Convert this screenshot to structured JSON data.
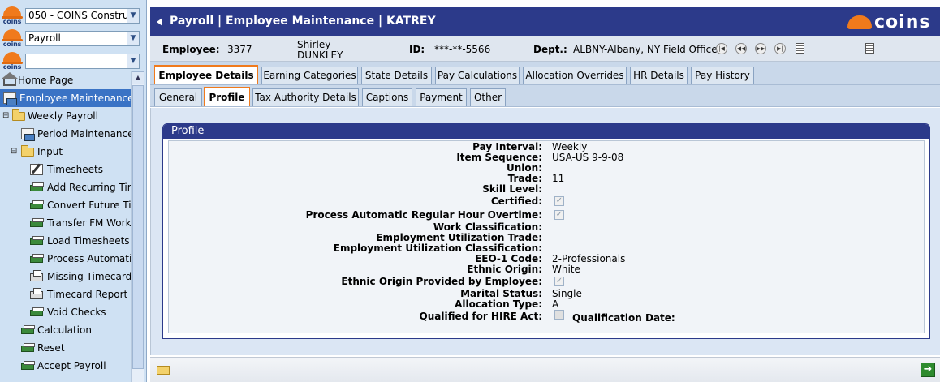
{
  "sidebar": {
    "company_select": "050 - COINS Constru",
    "module_select": "Payroll",
    "third_select": "",
    "logo_text": "coins",
    "tree": [
      {
        "label": "Home Page",
        "icon": "home-icon"
      },
      {
        "label": "Employee Maintenance",
        "icon": "document-icon",
        "active": true
      },
      {
        "label": "Weekly Payroll",
        "icon": "folder-icon"
      },
      {
        "label": "Period Maintenance",
        "icon": "document-icon"
      },
      {
        "label": "Input",
        "icon": "folder-icon"
      },
      {
        "label": "Timesheets",
        "icon": "edit-icon"
      },
      {
        "label": "Add Recurring Tim",
        "icon": "money-icon"
      },
      {
        "label": "Convert Future Ti",
        "icon": "money-icon"
      },
      {
        "label": "Transfer FM Work",
        "icon": "money-icon"
      },
      {
        "label": "Load Timesheets",
        "icon": "money-icon"
      },
      {
        "label": "Process Automatic",
        "icon": "money-icon"
      },
      {
        "label": "Missing Timecard",
        "icon": "printer-icon"
      },
      {
        "label": "Timecard Report",
        "icon": "printer-icon"
      },
      {
        "label": "Void Checks",
        "icon": "money-icon"
      },
      {
        "label": "Calculation",
        "icon": "money-icon"
      },
      {
        "label": "Reset",
        "icon": "money-icon"
      },
      {
        "label": "Accept Payroll",
        "icon": "money-icon"
      }
    ]
  },
  "header": {
    "title": "Payroll | Employee Maintenance | KATREY",
    "brand": "coins"
  },
  "employee": {
    "label": "Employee:",
    "number": "3377",
    "first": "Shirley",
    "last": "DUNKLEY",
    "id_label": "ID:",
    "id": "***-**-5566",
    "dept_label": "Dept.:",
    "dept": "ALBNY-Albany, NY Field Office"
  },
  "tabs_primary": [
    "Employee Details",
    "Earning Categories",
    "State Details",
    "Pay Calculations",
    "Allocation Overrides",
    "HR Details",
    "Pay History"
  ],
  "tabs_secondary": [
    "General",
    "Profile",
    "Tax Authority Details",
    "Captions",
    "Payment",
    "Other"
  ],
  "profile": {
    "title": "Profile",
    "fields": {
      "pay_interval": {
        "label": "Pay Interval:",
        "value": "Weekly"
      },
      "item_sequence": {
        "label": "Item Sequence:",
        "value": "USA-US 9-9-08"
      },
      "union": {
        "label": "Union:",
        "value": ""
      },
      "trade": {
        "label": "Trade:",
        "value": "11"
      },
      "skill_level": {
        "label": "Skill Level:",
        "value": ""
      },
      "certified": {
        "label": "Certified:",
        "checked": true
      },
      "auto_overtime": {
        "label": "Process Automatic Regular Hour Overtime:",
        "checked": true
      },
      "work_class": {
        "label": "Work Classification:",
        "value": ""
      },
      "emp_util_trade": {
        "label": "Employment Utilization Trade:",
        "value": ""
      },
      "emp_util_class": {
        "label": "Employment Utilization Classification:",
        "value": ""
      },
      "eeo1": {
        "label": "EEO-1 Code:",
        "value": "2-Professionals"
      },
      "ethnic": {
        "label": "Ethnic Origin:",
        "value": "White"
      },
      "ethnic_provided": {
        "label": "Ethnic Origin Provided by Employee:",
        "checked": true
      },
      "marital": {
        "label": "Marital Status:",
        "value": "Single"
      },
      "alloc_type": {
        "label": "Allocation Type:",
        "value": "A"
      },
      "hire_act": {
        "label": "Qualified for HIRE Act:",
        "checked": false
      },
      "qual_date": {
        "label": "Qualification Date:"
      }
    }
  }
}
